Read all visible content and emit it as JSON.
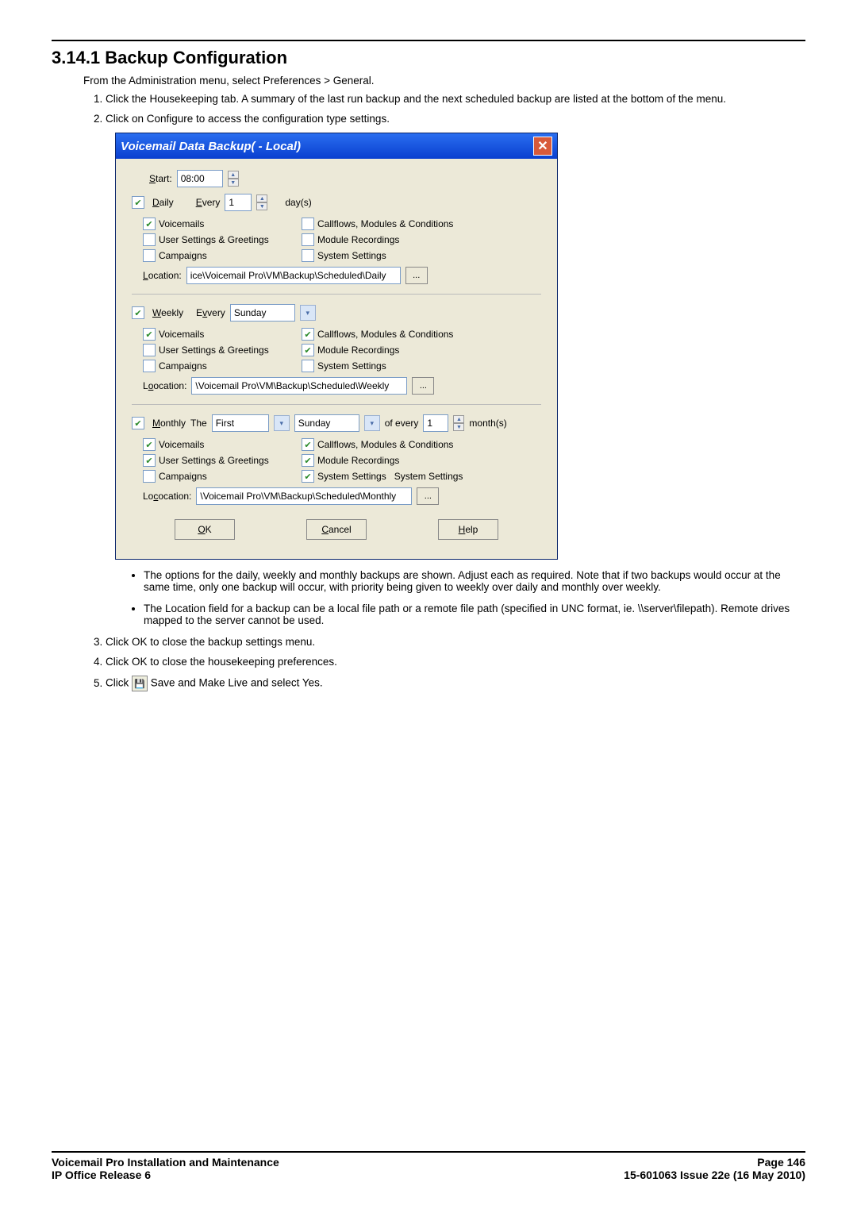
{
  "heading": "3.14.1 Backup Configuration",
  "intro": "From the Administration menu, select Preferences > General.",
  "steps": {
    "s1": "Click the Housekeeping tab. A summary of the last run backup and the next scheduled backup are listed at the bottom of the menu.",
    "s2": "Click on Configure to access the configuration type settings.",
    "s3": "Click OK to close the backup settings menu.",
    "s4": "Click OK to close the housekeeping preferences.",
    "s5_prefix": "Click ",
    "s5_suffix": " Save and Make Live and select Yes."
  },
  "bullets": {
    "b1": "The options for the daily, weekly and monthly backups are shown. Adjust each as required. Note that if two backups would occur at the same time, only one backup will occur, with priority being given to weekly over daily and monthly over weekly.",
    "b2": "The Location field for a backup can be a local file path or a remote file path (specified in UNC format, ie. \\\\server\\filepath). Remote drives mapped to the server cannot be used."
  },
  "dialog": {
    "title": "Voicemail Data Backup(  - Local)",
    "start": {
      "label_plain": "tart:",
      "value": "08:00"
    },
    "daily": {
      "label": "aily",
      "every": "very",
      "every_value": "1",
      "days": "day(s)",
      "voicemails": "Voicemails",
      "usersettings": "User Settings & Greetings",
      "campaigns": "Campaigns",
      "callflows": "Callflows, Modules & Conditions",
      "modulerec": "Module Recordings",
      "systemsettings": "System Settings",
      "location_label": "ocation:",
      "location_value": "ice\\Voicemail Pro\\VM\\Backup\\Scheduled\\Daily"
    },
    "weekly": {
      "label": "eekly",
      "every": "very",
      "day_value": "Sunday",
      "location_label": "ocation:",
      "location_value": "\\Voicemail Pro\\VM\\Backup\\Scheduled\\Weekly"
    },
    "monthly": {
      "label": "onthly",
      "the": "The",
      "ord_value": "First",
      "day_value": "Sunday",
      "ofevery": "of every",
      "count": "1",
      "months": "month(s)",
      "systemsettings_extra": "System Settings",
      "location_label": "ocation:",
      "location_value": "\\Voicemail Pro\\VM\\Backup\\Scheduled\\Monthly"
    },
    "buttons": {
      "ok": "K",
      "cancel": "ancel",
      "help": "elp"
    }
  },
  "footer": {
    "left1": "Voicemail Pro Installation and Maintenance",
    "left2": "IP Office Release 6",
    "right1": "Page 146",
    "right2": "15-601063 Issue 22e (16 May 2010)"
  }
}
